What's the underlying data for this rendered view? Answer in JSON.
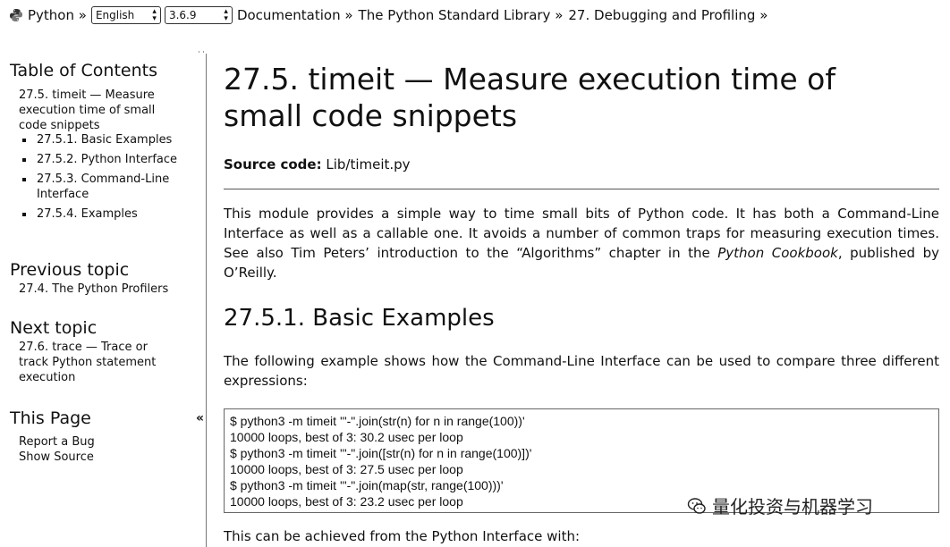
{
  "topbar": {
    "python_label": "Python »",
    "language_select": "English",
    "version_select": "3.6.9",
    "breadcrumbs": [
      "Documentation »",
      "The Python Standard Library »",
      "27. Debugging and Profiling »"
    ]
  },
  "sidebar": {
    "toc_title": "Table of Contents",
    "toc_main": "27.5. timeit — Measure execution time of small code snippets",
    "toc_items": [
      "27.5.1. Basic Examples",
      "27.5.2. Python Interface",
      "27.5.3. Command-Line Interface",
      "27.5.4. Examples"
    ],
    "previous_title": "Previous topic",
    "previous_link": "27.4. The Python Profilers",
    "next_title": "Next topic",
    "next_link": "27.6. trace — Trace or track Python statement execution",
    "this_page_title": "This Page",
    "this_page_links": [
      "Report a Bug",
      "Show Source"
    ],
    "collapse_glyph": "«"
  },
  "main": {
    "title": "27.5. timeit — Measure execution time of small code snippets",
    "source_label": "Source code:",
    "source_link": "Lib/timeit.py",
    "intro_before_italic": "This module provides a simple way to time small bits of Python code. It has both a Command-Line Interface as well as a callable one. It avoids a number of common traps for measuring execution times. See also Tim Peters’ introduction to the “Algorithms” chapter in the ",
    "intro_italic": "Python Cookbook",
    "intro_after_italic": ", published by O’Reilly.",
    "section_title": "27.5.1. Basic Examples",
    "section_intro": "The following example shows how the Command-Line Interface can be used to compare three different expressions:",
    "code_lines": [
      "$ python3 -m timeit '\"-\".join(str(n) for n in range(100))'",
      "10000 loops, best of 3: 30.2 usec per loop",
      "$ python3 -m timeit '\"-\".join([str(n) for n in range(100)])'",
      "10000 loops, best of 3: 27.5 usec per loop",
      "$ python3 -m timeit '\"-\".join(map(str, range(100)))'",
      "10000 loops, best of 3: 23.2 usec per loop"
    ],
    "after_code": "This can be achieved from the Python Interface with:"
  },
  "watermark": "量化投资与机器学习",
  "icons": {
    "python_logo": "python-logo-icon",
    "watermark_icon": "wechat-icon"
  }
}
